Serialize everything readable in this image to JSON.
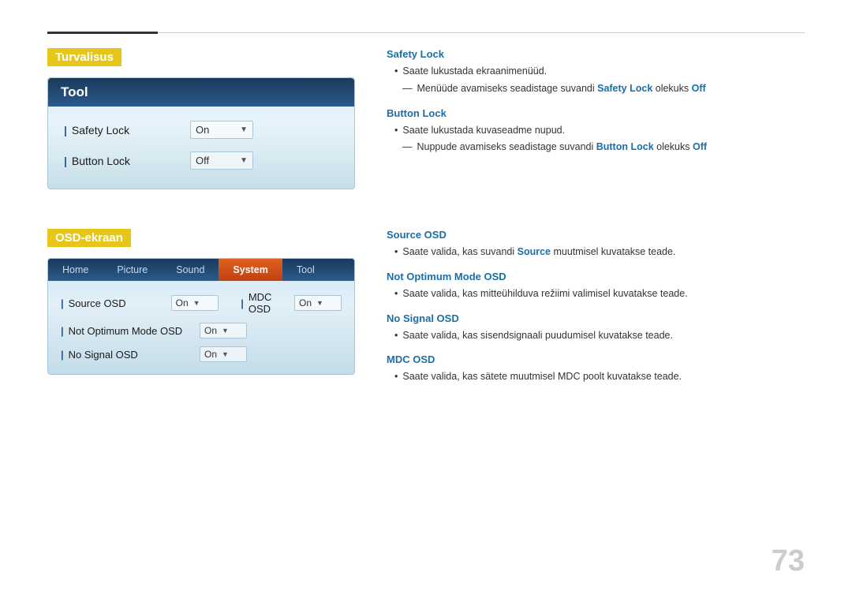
{
  "topRule": {},
  "section1": {
    "heading": "Turvalisus",
    "panel": {
      "title": "Tool",
      "rows": [
        {
          "label": "Safety Lock",
          "value": "On"
        },
        {
          "label": "Button Lock",
          "value": "Off"
        }
      ]
    },
    "desc": {
      "safetyLock": {
        "title": "Safety Lock",
        "bullet1": "Saate lukustada ekraanimenüüd.",
        "sub1_prefix": "Menüüde avamiseks seadistage suvandi ",
        "sub1_bold": "Safety Lock",
        "sub1_suffix": " olekuks ",
        "sub1_value": "Off"
      },
      "buttonLock": {
        "title": "Button Lock",
        "bullet1": "Saate lukustada kuvaseadme nupud.",
        "sub1_prefix": "Nuppude avamiseks seadistage suvandi ",
        "sub1_bold": "Button Lock",
        "sub1_suffix": " olekuks ",
        "sub1_value": "Off"
      }
    }
  },
  "section2": {
    "heading": "OSD-ekraan",
    "panel": {
      "menuItems": [
        {
          "label": "Home",
          "state": "normal"
        },
        {
          "label": "Picture",
          "state": "normal"
        },
        {
          "label": "Sound",
          "state": "normal"
        },
        {
          "label": "System",
          "state": "highlight"
        },
        {
          "label": "Tool",
          "state": "normal"
        }
      ],
      "rows": [
        {
          "label": "Source OSD",
          "value1": "On",
          "label2": "MDC OSD",
          "value2": "On"
        },
        {
          "label": "Not Optimum Mode OSD",
          "value1": "On",
          "label2": null,
          "value2": null
        },
        {
          "label": "No Signal OSD",
          "value1": "On",
          "label2": null,
          "value2": null
        }
      ]
    },
    "desc": {
      "sourceOSD": {
        "title": "Source OSD",
        "bullet1_prefix": "Saate valida, kas suvandi ",
        "bullet1_bold": "Source",
        "bullet1_suffix": " muutmisel kuvatakse teade."
      },
      "notOptimum": {
        "title": "Not Optimum Mode OSD",
        "bullet1": "Saate valida, kas mitteühilduva režiimi valimisel kuvatakse teade."
      },
      "noSignal": {
        "title": "No Signal OSD",
        "bullet1": "Saate valida, kas sisendsignaali puudumisel kuvatakse teade."
      },
      "mdcOSD": {
        "title": "MDC OSD",
        "bullet1": "Saate valida, kas sätete muutmisel MDC poolt kuvatakse teade."
      }
    }
  },
  "pageNumber": "73"
}
